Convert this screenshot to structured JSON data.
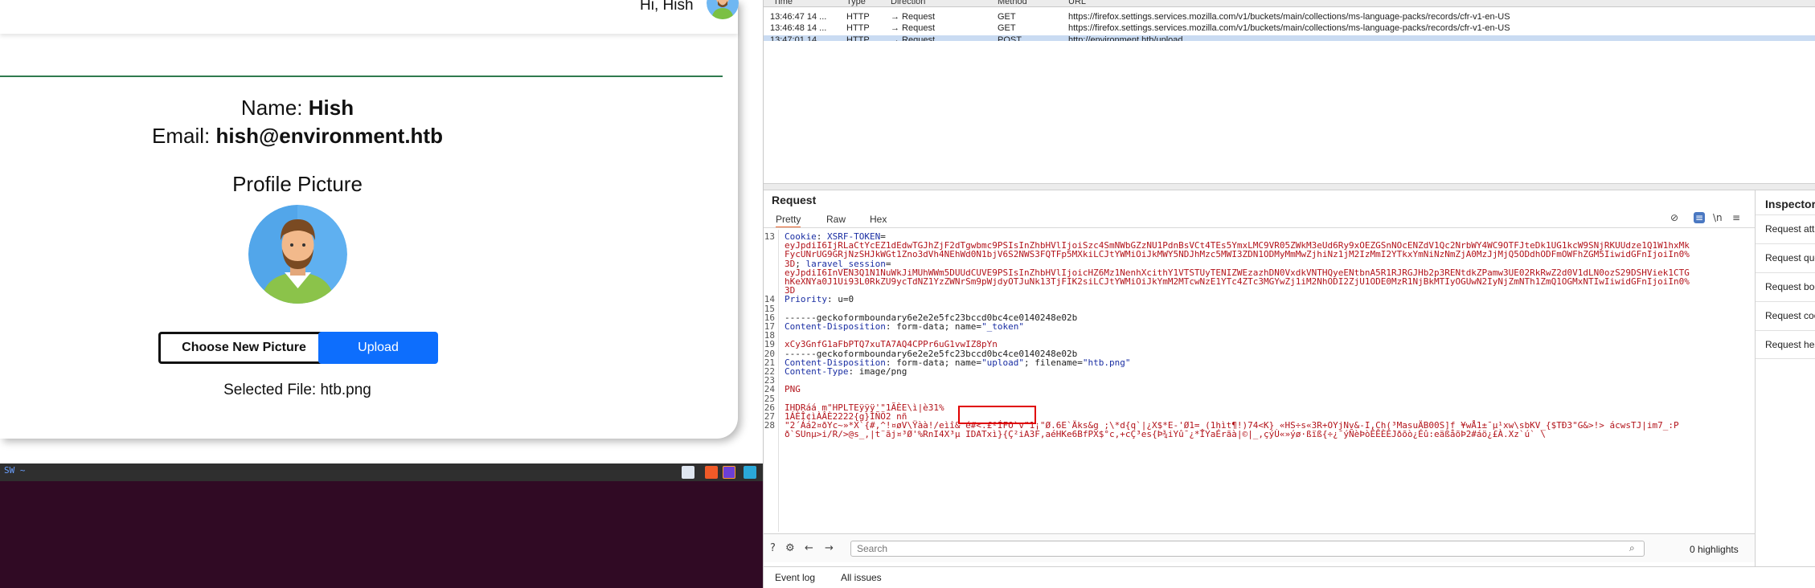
{
  "webpage": {
    "greeting": "Hi, Hish",
    "name_label": "Name:",
    "name_value": "Hish",
    "email_label": "Email:",
    "email_value": "hish@environment.htb",
    "profile_heading": "Profile Picture",
    "choose_button": "Choose New Picture",
    "upload_button": "Upload",
    "selected_file": "Selected File: htb.png"
  },
  "taskbar": {
    "label": "SW  ~"
  },
  "burp": {
    "history_columns": [
      "Time",
      "Type",
      "Direction",
      "Method",
      "URL"
    ],
    "history_rows": [
      {
        "time": "13:46:47 14 ...",
        "type": "HTTP",
        "direction": "→ Request",
        "method": "GET",
        "url": "https://firefox.settings.services.mozilla.com/v1/buckets/main/collections/ms-language-packs/records/cfr-v1-en-US"
      },
      {
        "time": "13:46:48 14 ...",
        "type": "HTTP",
        "direction": "→ Request",
        "method": "GET",
        "url": "https://firefox.settings.services.mozilla.com/v1/buckets/main/collections/ms-language-packs/records/cfr-v1-en-US"
      },
      {
        "time": "13:47:01 14 ...",
        "type": "HTTP",
        "direction": "→ Request",
        "method": "POST",
        "url": "http://environment.htb/upload"
      }
    ],
    "request_title": "Request",
    "tabs": [
      "Pretty",
      "Raw",
      "Hex"
    ],
    "code_lines": [
      {
        "n": "13",
        "parts": [
          [
            "k",
            "Cookie"
          ],
          [
            "t",
            ": "
          ],
          [
            "s",
            "XSRF-TOKEN"
          ],
          [
            "t",
            "="
          ]
        ]
      },
      {
        "n": "",
        "parts": [
          [
            "v",
            "eyJpdiI6IjRLaCtYcEZ1dEdwTGJhZjF2dTgwbmc9PSIsInZhbHVlIjoiSzc4SmNWbGZzNU1PdnBsVCt4TEs5YmxLMC9VR05ZWkM3eUd6Ry9xOEZGSnNOcENZdV1Qc2NrbWY4WC9OTFJteDk1UG1kcW9SNjRKUUdze1Q1W1hxMk"
          ]
        ]
      },
      {
        "n": "",
        "parts": [
          [
            "v",
            "FycUNrUG9GRjNzSHJkWGt1Zno3dVh4NEhWd0N1bjV6S2NWS3FQTFp5MXkiLCJtYWMiOiJkMWY5NDJhMzc5MWI3ZDN1ODMyMmMwZjhiNz1jM2IzMmI2YTkxYmNiNzNmZjA0MzJjMjQ5ODdhODFmOWFhZGM5IiwidGFnIjoiIn0%"
          ]
        ]
      },
      {
        "n": "",
        "parts": [
          [
            "v",
            "3D"
          ],
          [
            "t",
            "; "
          ],
          [
            "s",
            "laravel_session"
          ],
          [
            "t",
            "="
          ]
        ]
      },
      {
        "n": "",
        "parts": [
          [
            "v",
            "eyJpdiI6InVEN3Q1N1NuWkJiMUhWWm5DUUdCUVE9PSIsInZhbHVlIjoicHZ6Mz1NenhXcithY1VTSTUyTENIZWEzazhDN0VxdkVNTHQyeENtbnA5R1RJRGJHb2p3RENtdkZPamw3UE02RkRwZ2d0V1dLN0ozS29DSHViek1CTG"
          ]
        ]
      },
      {
        "n": "",
        "parts": [
          [
            "v",
            "hKeXNYa0J1Ui93L0RkZU9ycTdNZ1YzZWNrSm9pWjdyOTJuNk13TjFIK2siLCJtYWMiOiJkYmM2MTcwNzE1YTc4ZTc3MGYwZj1iM2NhODI2ZjU1ODE0MzR1NjBkMTIyOGUwN2IyNjZmNTh1ZmQ1OGMxNTIwIiwidGFnIjoiIn0%"
          ]
        ]
      },
      {
        "n": "",
        "parts": [
          [
            "v",
            "3D"
          ]
        ]
      },
      {
        "n": "14",
        "parts": [
          [
            "k",
            "Priority"
          ],
          [
            "t",
            ": u=0"
          ]
        ]
      },
      {
        "n": "15",
        "parts": [
          [
            "t",
            ""
          ]
        ]
      },
      {
        "n": "16",
        "parts": [
          [
            "t",
            "------geckoformboundary6e2e2e5fc23bccd0bc4ce0140248e02b"
          ]
        ]
      },
      {
        "n": "17",
        "parts": [
          [
            "k",
            "Content-Disposition"
          ],
          [
            "t",
            ": form-data; name="
          ],
          [
            "s",
            "\"_token\""
          ]
        ]
      },
      {
        "n": "18",
        "parts": [
          [
            "t",
            ""
          ]
        ]
      },
      {
        "n": "19",
        "parts": [
          [
            "v",
            "xCy3GnfG1aFbPTQ7xuTA7AQ4CPPr6uG1vwIZ8pYn"
          ]
        ]
      },
      {
        "n": "20",
        "parts": [
          [
            "t",
            "------geckoformboundary6e2e2e5fc23bccd0bc4ce0140248e02b"
          ]
        ]
      },
      {
        "n": "21",
        "parts": [
          [
            "k",
            "Content-Disposition"
          ],
          [
            "t",
            ": form-data; name="
          ],
          [
            "s",
            "\"upload\""
          ],
          [
            "t",
            "; filename="
          ],
          [
            "s",
            "\"htb.png\""
          ]
        ]
      },
      {
        "n": "22",
        "parts": [
          [
            "k",
            "Content-Type"
          ],
          [
            "t",
            ": image/png"
          ]
        ]
      },
      {
        "n": "23",
        "parts": [
          [
            "t",
            ""
          ]
        ]
      },
      {
        "n": "24",
        "parts": [
          [
            "v",
            "PNG"
          ]
        ]
      },
      {
        "n": "25",
        "parts": [
          [
            "t",
            ""
          ]
        ]
      },
      {
        "n": "26",
        "parts": [
          [
            "v",
            "IHDRáá m\"HPLTEÿÿÿ'\"1ÃÈE\\ì|è31%"
          ]
        ]
      },
      {
        "n": "27",
        "parts": [
          [
            "v",
            "1ÁÈÎ¢ìÀÂÈ2222{g}ÌÑÖ2 nñ"
          ]
        ]
      },
      {
        "n": "28",
        "parts": [
          [
            "v",
            "\"2´Áá2¤ðYc~»*X`{#,^!¤øV\\Ÿàà!/eìî& é#<.£²ÍFO`v¨1¡\"Ø.6E`Äks&g ;\\*d{q`|¿X$*E-'Ø1=_(1hìt¶!)74<K} «HS÷s«3R+OYjNv&-I,Ch(³MasuÄB00S]f ¥wÅ1±¯µ¹xw\\sbKV_{$TÐ3\"G&>!> ácwsTJ|im7_:P"
          ]
        ]
      },
      {
        "n": "",
        "parts": [
          [
            "v",
            "ð`SUnµ>i/R/>@s_,|t¨ãj¤³Ø'%RnI4X³µ IDATxì}{Ç²iA3F,aéHKe6BfPX$°c,+cÇ³es{Þ¾iYû¯¿*ÎYaÉrãà|©|_,çýÙ«»ýø·ßïß{÷¿¯ýÑèÞòÊÊÈÈJðõò¿Éû:eäßåõÞ2#áö¿£À.Xz`ú` \\"
          ]
        ]
      }
    ],
    "search_placeholder": "Search",
    "highlights": "0 highlights",
    "bottom_tabs": [
      "Event log",
      "All issues"
    ],
    "inspector_title": "Inspector",
    "inspector_items": [
      "Request attributes",
      "Request query parameters",
      "Request body parameters",
      "Request cookies",
      "Request headers"
    ]
  },
  "colors": {
    "accent": "#0d6efd",
    "divider": "#2f7a4e",
    "terminal": "#300a24",
    "highlight_box": "#e00000",
    "selected_row": "#c9dbf2"
  }
}
